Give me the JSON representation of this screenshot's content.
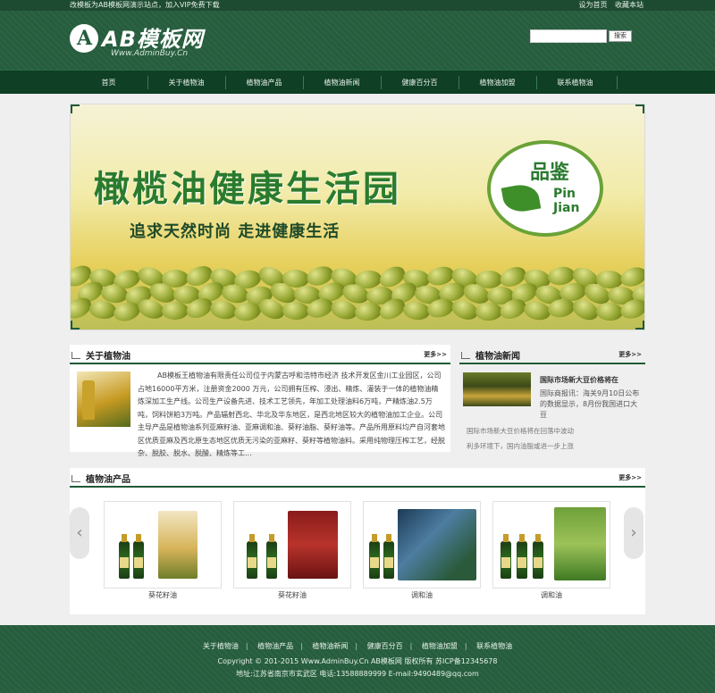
{
  "topbar": {
    "notice": "改模板为AB模板网演示站点，加入VIP免费下载",
    "links": [
      "设为首页",
      "收藏本站"
    ]
  },
  "logo": {
    "name": "AB模板网",
    "mark": "A",
    "subtitle": "Www.AdminBuy.Cn"
  },
  "search": {
    "placeholder": "",
    "button": "搜索"
  },
  "nav": [
    "首页",
    "关于植物油",
    "植物油产品",
    "植物油新闻",
    "健康百分百",
    "植物油加盟",
    "联系植物油"
  ],
  "banner": {
    "headline": "橄榄油健康生活园",
    "tagline": "追求天然时尚  走进健康生活",
    "badge_cn": "品鉴",
    "badge_en_1": "Pin",
    "badge_en_2": "Jian"
  },
  "about": {
    "title": "关于植物油",
    "more": "更多>>",
    "text": "AB模板王植物油有限责任公司位于内蒙古呼和浩特市经济 技术开发区金川工业园区，公司占地16000平方米，注册资金2000 万元，公司拥有压榨、浸出、精炼、灌装于一体的植物油精炼深加工生产线。公司生产设备先进、技术工艺领先，年加工处理油料6万吨，产精炼油2.5万吨，饲料饼粕3万吨。产品辐射西北、华北及华东地区，是西北地区较大的植物油加工企业。公司主导产品是植物油系列亚麻籽油、亚麻调和油、葵籽油脂、葵籽油等。产品所用原料均产自河套地区优质亚麻及西北原生态地区优质无污染的亚麻籽、葵籽等植物油料。采用纯物理压榨工艺，经脱杂、脱胶、脱水、脱酸、精炼等工..."
  },
  "news": {
    "title": "植物油新闻",
    "more": "更多>>",
    "feature_title": "国际市场新大豆价格将在",
    "feature_desc": "国际商报讯：海关9月10日公布的数据显示，8月份我国进口大豆",
    "items": [
      "国际市场新大豆价格将在回落中波动",
      "利多环境下，国内油脂或进一步上涨"
    ]
  },
  "products": {
    "title": "植物油产品",
    "more": "更多>>",
    "items": [
      {
        "caption": "葵花籽油"
      },
      {
        "caption": "葵花籽油"
      },
      {
        "caption": "调和油"
      },
      {
        "caption": "调和油"
      }
    ],
    "arrow_left": "‹",
    "arrow_right": "›"
  },
  "footer": {
    "links": [
      "关于植物油",
      "植物油产品",
      "植物油新闻",
      "健康百分百",
      "植物油加盟",
      "联系植物油"
    ],
    "separator": "|",
    "copyright": "Copyright © 201-2015 Www.AdminBuy.Cn AB模板网 版权所有   苏ICP备12345678",
    "address": "地址:江苏省南京市玄武区   电话:13588889999   E-mail:9490489@qq.com"
  },
  "colors": {
    "brand_green": "#255d3d",
    "nav_dark": "#0f3f25",
    "accent_olive": "#6aa237"
  }
}
